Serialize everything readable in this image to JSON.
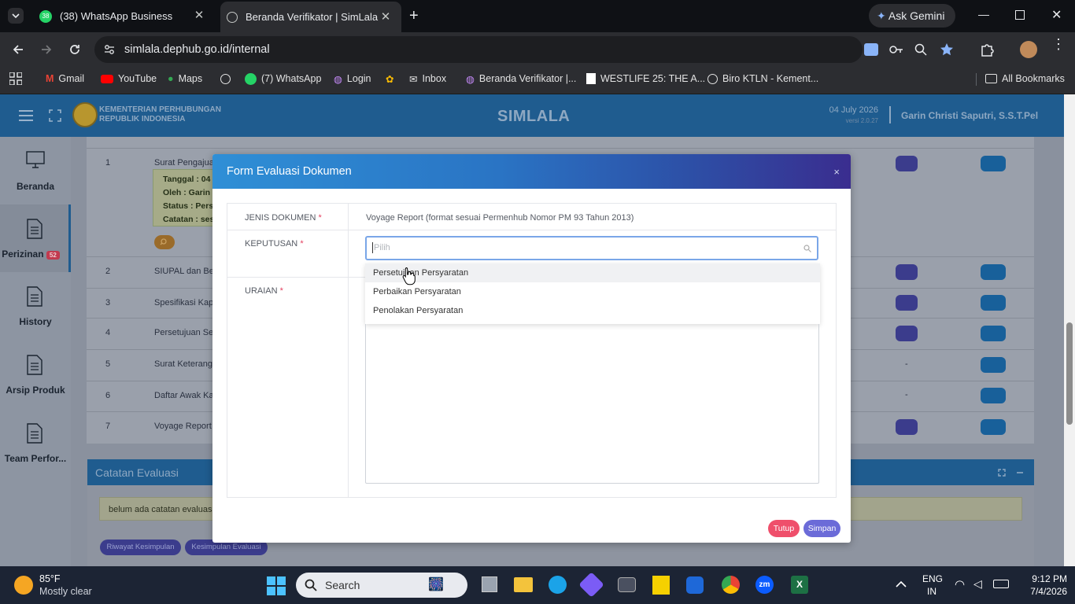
{
  "browser": {
    "tabs": [
      {
        "label": "(38) WhatsApp Business",
        "badge": "38"
      },
      {
        "label": "Beranda Verifikator | SimLala"
      }
    ],
    "ask_gemini": "Ask Gemini",
    "url": "simlala.dephub.go.id/internal",
    "bookmarks": [
      {
        "label": "Gmail",
        "icon": "gmail-icon"
      },
      {
        "label": "YouTube",
        "icon": "youtube-icon"
      },
      {
        "label": "Maps",
        "icon": "maps-icon"
      },
      {
        "label": "",
        "icon": "globe-icon"
      },
      {
        "label": "(7) WhatsApp",
        "icon": "whatsapp-icon"
      },
      {
        "label": "Login",
        "icon": "login-icon"
      },
      {
        "label": "Inbox",
        "icon": "photos-icon"
      },
      {
        "label": "Inbox",
        "icon": "mail-icon"
      },
      {
        "label": "Beranda Verifikator |...",
        "icon": "site-icon"
      },
      {
        "label": "WESTLIFE 25: THE A...",
        "icon": "bookmark-icon"
      },
      {
        "label": "Biro KTLN - Kement...",
        "icon": "globe-icon"
      }
    ],
    "all_bookmarks": "All Bookmarks"
  },
  "app": {
    "org_line1": "KEMENTERIAN PERHUBUNGAN",
    "org_line2": "REPUBLIK INDONESIA",
    "title": "SIMLALA",
    "date": "04 July 2026",
    "version": "versi 2.0.27",
    "user": "Garin Christi Saputri, S.S.T.Pel"
  },
  "nav": [
    {
      "label": "Beranda",
      "icon": "monitor-icon"
    },
    {
      "label": "Perizinan",
      "icon": "document-icon",
      "badge": "52"
    },
    {
      "label": "History",
      "icon": "document-icon"
    },
    {
      "label": "Arsip Produk",
      "icon": "document-icon"
    },
    {
      "label": "Team Perfor...",
      "icon": "document-icon"
    }
  ],
  "table": {
    "rows": [
      {
        "no": "1",
        "name": "Surat Pengajuan"
      },
      {
        "no": "2",
        "name": "SIUPAL dan Beri"
      },
      {
        "no": "3",
        "name": "Spesifikasi Kapa"
      },
      {
        "no": "4",
        "name": "Persetujuan Seb"
      },
      {
        "no": "5",
        "name": "Surat Keterangan"
      },
      {
        "no": "6",
        "name": "Daftar Awak Kap"
      },
      {
        "no": "7",
        "name": "Voyage Report ("
      }
    ],
    "row1_details": {
      "tanggal": "Tanggal : 04",
      "oleh": "Oleh : Garin",
      "status": "Status : Pers",
      "catatan": "Catatan : ses"
    },
    "dash": "-"
  },
  "catatan": {
    "title": "Catatan Evaluasi",
    "empty_text": "belum ada catatan evaluasi",
    "btn_riwayat": "Riwayat Kesimpulan",
    "btn_kesimpulan": "Kesimpulan Evaluasi"
  },
  "modal": {
    "title": "Form Evaluasi Dokumen",
    "close": "×",
    "jenis_label": "JENIS DOKUMEN",
    "jenis_value": "Voyage Report (format sesuai Permenhub Nomor PM 93 Tahun 2013)",
    "keputusan_label": "KEPUTUSAN",
    "select_placeholder": "Pilih",
    "options": [
      "Persetujuan Persyaratan",
      "Perbaikan Persyaratan",
      "Penolakan Persyaratan"
    ],
    "uraian_label": "URAIAN",
    "required_mark": "*",
    "btn_tutup": "Tutup",
    "btn_simpan": "Simpan"
  },
  "taskbar": {
    "weather_temp": "85°F",
    "weather_desc": "Mostly clear",
    "search": "Search",
    "lang1": "ENG",
    "lang2": "IN",
    "time": "9:12 PM",
    "date": "7/4/2026"
  },
  "colors": {
    "accent": "#2f8fd6",
    "danger": "#ef4f6b",
    "primary_btn": "#6b6bd8",
    "badge": "#e0304e"
  }
}
